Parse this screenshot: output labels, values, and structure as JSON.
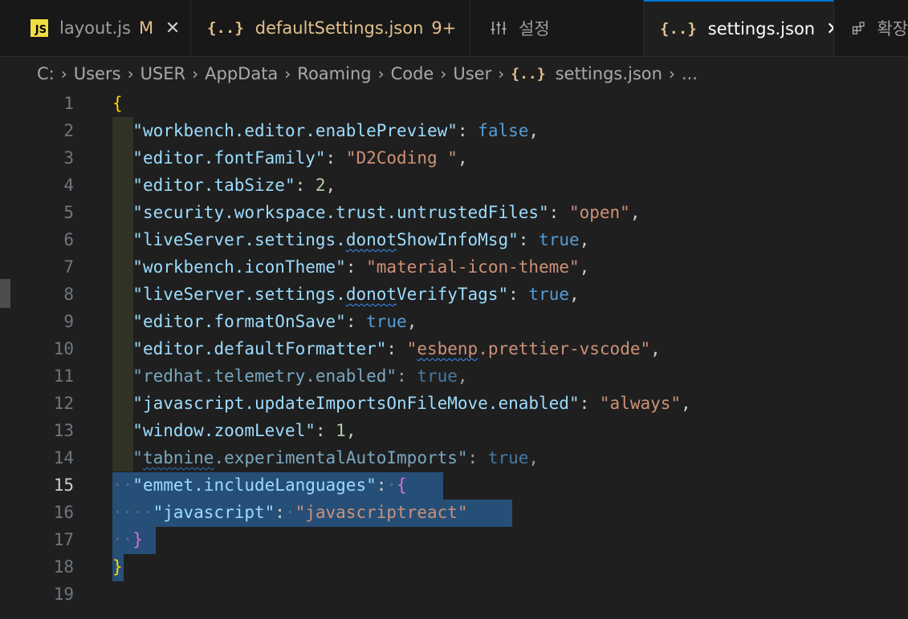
{
  "tabs": [
    {
      "label": "layout.js",
      "modifier": "M",
      "icon": "js-file-icon",
      "active": false
    },
    {
      "label": "defaultSettings.json",
      "modifier": "9+",
      "icon": "json-file-icon",
      "active": false
    },
    {
      "label": "설정",
      "modifier": "",
      "icon": "settings-sliders-icon",
      "active": false
    },
    {
      "label": "settings.json",
      "modifier": "",
      "icon": "json-file-icon",
      "active": true
    },
    {
      "label": "확장",
      "modifier": "",
      "icon": "extensions-icon",
      "active": false
    }
  ],
  "json_icon_glyph": "{..}",
  "js_icon_glyph": "JS",
  "close_glyph": "✕",
  "breadcrumb": [
    "C:",
    "Users",
    "USER",
    "AppData",
    "Roaming",
    "Code",
    "User",
    "settings.json",
    "..."
  ],
  "editor": {
    "current_line": 15,
    "line_numbers": [
      "1",
      "2",
      "3",
      "4",
      "5",
      "6",
      "7",
      "8",
      "9",
      "10",
      "11",
      "12",
      "13",
      "14",
      "15",
      "16",
      "17",
      "18",
      "19"
    ],
    "lines": {
      "l1_open": "{",
      "l2_key": "\"workbench.editor.enablePreview\"",
      "l2_val": "false",
      "l3_key": "\"editor.fontFamily\"",
      "l3_val": "\"D2Coding \"",
      "l4_key": "\"editor.tabSize\"",
      "l4_val": "2",
      "l5_key": "\"security.workspace.trust.untrustedFiles\"",
      "l5_val": "\"open\"",
      "l6_key_a": "\"liveServer.settings.",
      "l6_key_b": "donot",
      "l6_key_c": "ShowInfoMsg\"",
      "l6_val": "true",
      "l7_key": "\"workbench.iconTheme\"",
      "l7_val": "\"material-icon-theme\"",
      "l8_key_a": "\"liveServer.settings.",
      "l8_key_b": "donot",
      "l8_key_c": "VerifyTags\"",
      "l8_val": "true",
      "l9_key": "\"editor.formatOnSave\"",
      "l9_val": "true",
      "l10_key": "\"editor.defaultFormatter\"",
      "l10_val_a": "\"",
      "l10_val_b": "esbenp",
      "l10_val_c": ".prettier-vscode\"",
      "l11_key": "\"redhat.telemetry.enabled\"",
      "l11_val": "true",
      "l12_key": "\"javascript.updateImportsOnFileMove.enabled\"",
      "l12_val": "\"always\"",
      "l13_key": "\"window.zoomLevel\"",
      "l13_val": "1",
      "l14_key_a": "\"",
      "l14_key_b": "tabnine",
      "l14_key_c": ".experimentalAutoImports\"",
      "l14_val": "true",
      "l15_key": "\"emmet.includeLanguages\"",
      "l15_open": "{",
      "l16_key": "\"javascript\"",
      "l16_val": "\"javascriptreact\"",
      "l17_close": "}",
      "l18_close": "}"
    }
  },
  "colors": {
    "editor_bg": "#1f1f1f",
    "tab_active_border": "#0078d4",
    "selection": "#264f78",
    "json_key": "#9cdcfe",
    "json_string": "#ce9178",
    "json_keyword": "#569cd6",
    "json_number": "#b5cea8",
    "brace_level1": "#ffd700",
    "brace_level2": "#da70d6",
    "json_icon": "#e2c08d"
  }
}
